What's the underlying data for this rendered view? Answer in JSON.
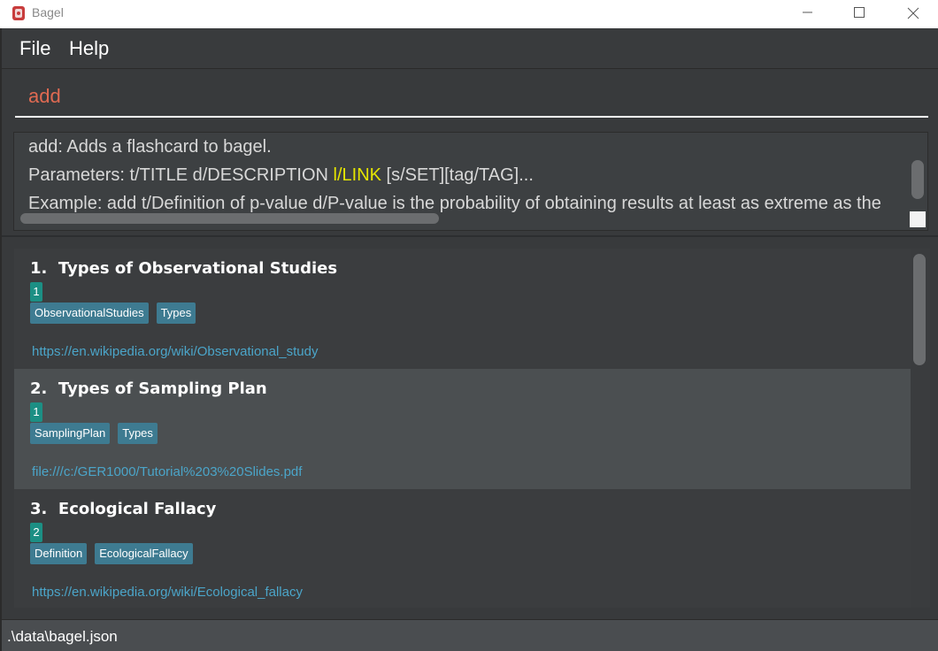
{
  "window": {
    "title": "Bagel",
    "icon": "bagel-app-icon"
  },
  "menu": {
    "items": [
      "File",
      "Help"
    ]
  },
  "command": {
    "value": "add"
  },
  "result": {
    "line1": "add: Adds a flashcard to bagel.",
    "line2_a": "Parameters: t/TITLE d/DESCRIPTION ",
    "line2_hl": "l/LINK",
    "line2_b": " [s/SET][tag/TAG]...",
    "line3": "Example: add t/Definition of p-value d/P-value is  the probability of obtaining results at least as extreme as the"
  },
  "flashcards": [
    {
      "index": "1.",
      "title": "Types of Observational Studies",
      "set": "1",
      "tags": [
        "ObservationalStudies",
        "Types"
      ],
      "link": "https://en.wikipedia.org/wiki/Observational_study",
      "selected": false
    },
    {
      "index": "2.",
      "title": "Types of Sampling Plan",
      "set": "1",
      "tags": [
        "SamplingPlan",
        "Types"
      ],
      "link": "file:///c:/GER1000/Tutorial%203%20Slides.pdf",
      "selected": true
    },
    {
      "index": "3.",
      "title": "Ecological Fallacy",
      "set": "2",
      "tags": [
        "Definition",
        "EcologicalFallacy"
      ],
      "link": "https://en.wikipedia.org/wiki/Ecological_fallacy",
      "selected": false
    }
  ],
  "status": {
    "path": ".\\data\\bagel.json"
  },
  "colors": {
    "background": "#383a3c",
    "command_text": "#e06a52",
    "highlight": "#e5e500",
    "set_badge": "#1c8f84",
    "tag": "#3e7b91",
    "link": "#4ba5c9",
    "selected_card": "#4b4f51"
  }
}
